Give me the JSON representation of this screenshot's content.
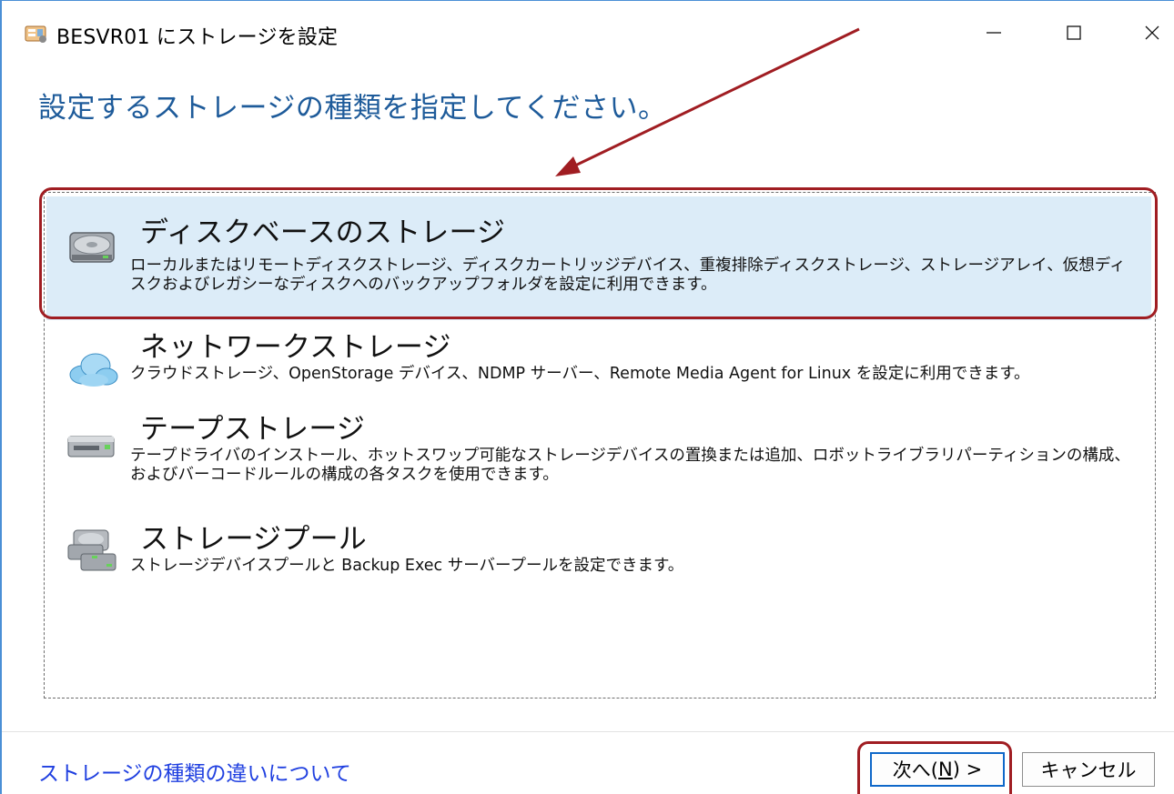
{
  "window": {
    "title": "BESVR01 にストレージを設定",
    "controls": {
      "minimize": "—",
      "maximize": "☐",
      "close": "✕"
    }
  },
  "heading": "設定するストレージの種類を指定してください。",
  "options": [
    {
      "title": "ディスクベースのストレージ",
      "description": "ローカルまたはリモートディスクストレージ、ディスクカートリッジデバイス、重複排除ディスクストレージ、ストレージアレイ、仮想ディスクおよびレガシーなディスクへのバックアップフォルダを設定に利用できます。",
      "icon": "hard-disk-icon",
      "selected": true
    },
    {
      "title": "ネットワークストレージ",
      "description": "クラウドストレージ、OpenStorage デバイス、NDMP サーバー、Remote Media Agent for Linux を設定に利用できます。",
      "icon": "cloud-icon",
      "selected": false
    },
    {
      "title": "テープストレージ",
      "description": "テープドライバのインストール、ホットスワップ可能なストレージデバイスの置換または追加、ロボットライブラリパーティションの構成、およびバーコードルールの構成の各タスクを使用できます。",
      "icon": "tape-drive-icon",
      "selected": false
    },
    {
      "title": "ストレージプール",
      "description": "ストレージデバイスプールと Backup Exec サーバープールを設定できます。",
      "icon": "storage-pool-icon",
      "selected": false
    }
  ],
  "footer": {
    "help_link": "ストレージの種類の違いについて",
    "next_prefix": "次へ(",
    "next_mnemonic": "N",
    "next_suffix": ") >",
    "cancel": "キャンセル"
  },
  "colors": {
    "heading": "#1e5b9a",
    "selected_bg": "#dcecf8",
    "link": "#1f3fe0",
    "annotation": "#a01d22",
    "window_border": "#4a8fd6"
  }
}
